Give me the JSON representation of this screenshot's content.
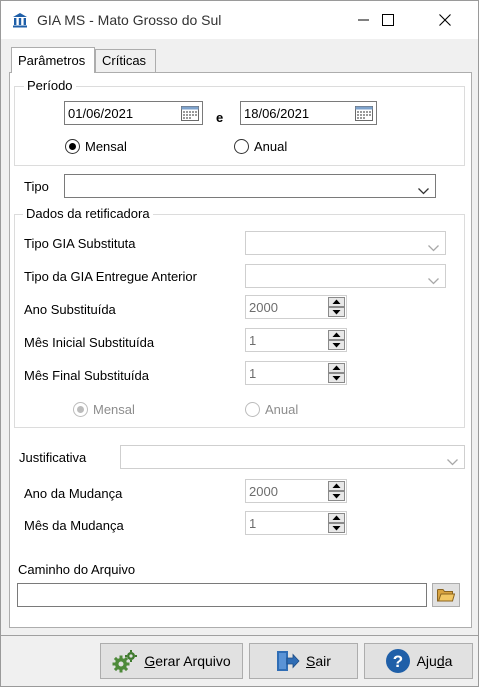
{
  "window": {
    "title": "GIA MS - Mato Grosso do Sul"
  },
  "tabs": [
    {
      "label": "Parâmetros",
      "active": true
    },
    {
      "label": "Críticas",
      "active": false
    }
  ],
  "periodo": {
    "legend": "Período",
    "start_date": "01/06/2021",
    "separator": "e",
    "end_date": "18/06/2021",
    "options": [
      {
        "label": "Mensal",
        "checked": true
      },
      {
        "label": "Anual",
        "checked": false
      }
    ]
  },
  "tipo": {
    "label": "Tipo",
    "value": ""
  },
  "retificadora": {
    "legend": "Dados da retificadora",
    "tipo_gia_substituta_label": "Tipo GIA Substituta",
    "tipo_gia_entregue_label": "Tipo da GIA Entregue Anterior",
    "ano_substituida_label": "Ano Substituída",
    "ano_substituida_value": "2000",
    "mes_inicial_label": "Mês Inicial Substituída",
    "mes_inicial_value": "1",
    "mes_final_label": "Mês Final Substituída",
    "mes_final_value": "1",
    "options": [
      {
        "label": "Mensal",
        "checked": true
      },
      {
        "label": "Anual",
        "checked": false
      }
    ]
  },
  "justificativa": {
    "label": "Justificativa",
    "value": "",
    "ano_mudanca_label": "Ano da Mudança",
    "ano_mudanca_value": "2000",
    "mes_mudanca_label": "Mês da Mudança",
    "mes_mudanca_value": "1"
  },
  "arquivo": {
    "label": "Caminho do Arquivo",
    "value": ""
  },
  "buttons": {
    "gerar_first": "G",
    "gerar_rest": "erar Arquivo",
    "sair_first": "S",
    "sair_rest": "air",
    "ajuda_pre": "Aju",
    "ajuda_u": "d",
    "ajuda_post": "a"
  },
  "colors": {
    "titlebar": "#ffffff",
    "panel": "#ffffff",
    "window_bg": "#f0f0f0",
    "icon_blue": "#1f5fa8"
  }
}
